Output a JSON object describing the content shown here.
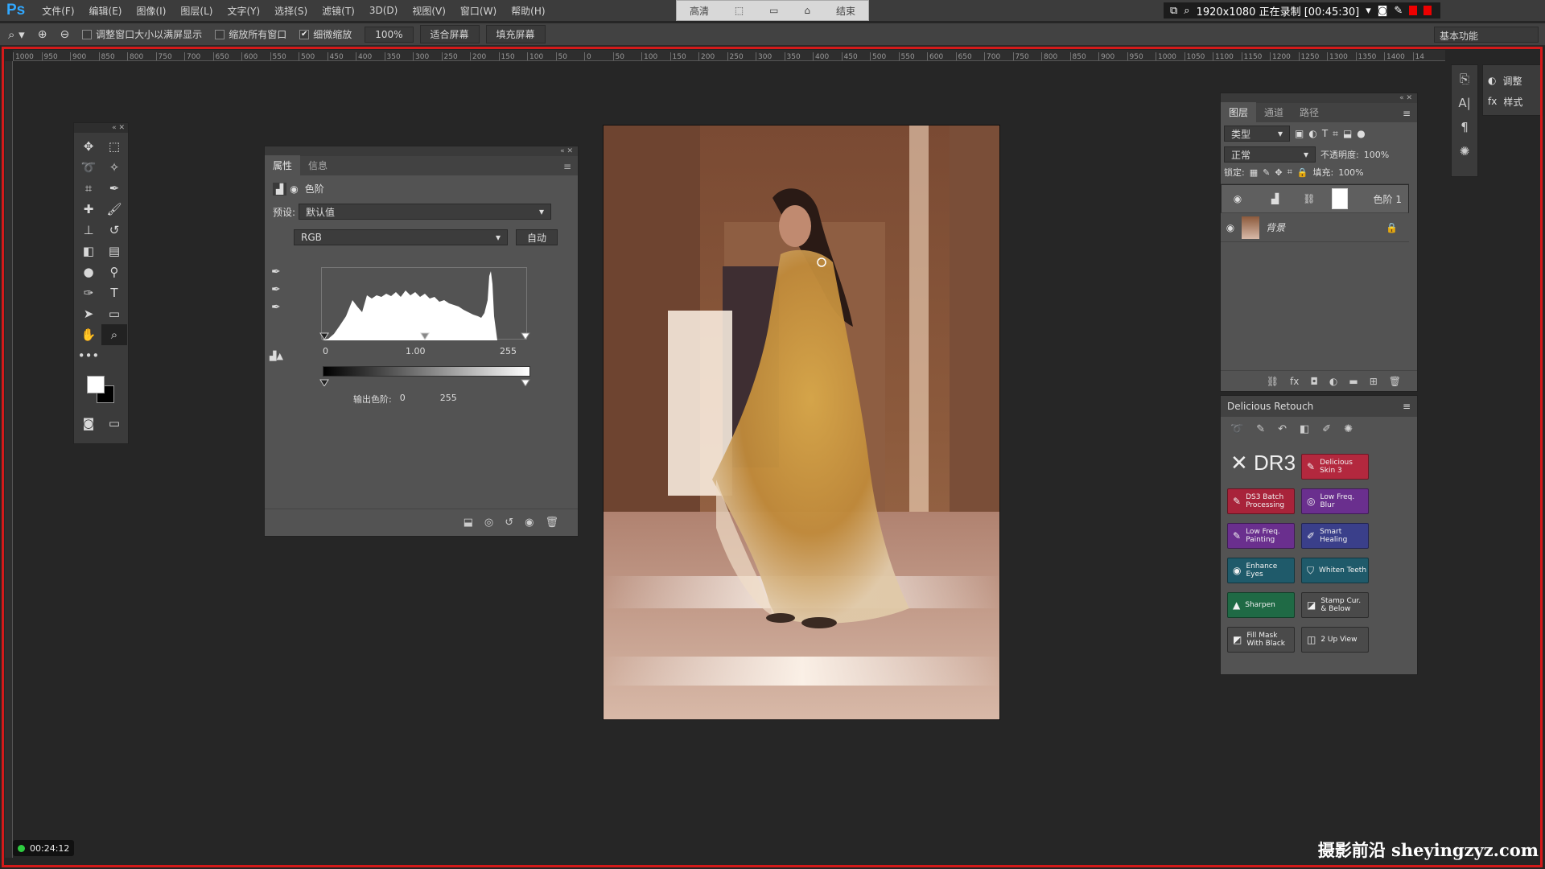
{
  "app": {
    "logo": "Ps"
  },
  "menu": [
    "文件(F)",
    "编辑(E)",
    "图像(I)",
    "图层(L)",
    "文字(Y)",
    "选择(S)",
    "滤镜(T)",
    "3D(D)",
    "视图(V)",
    "窗口(W)",
    "帮助(H)"
  ],
  "recorder_toolbar": [
    "高清",
    "结束"
  ],
  "recorder_status": {
    "text": "1920x1080 正在录制 [00:45:30]"
  },
  "options": {
    "chk1": "调整窗口大小以满屏显示",
    "chk2": "缩放所有窗口",
    "chk3": "细微缩放",
    "zoom": "100%",
    "fit": "适合屏幕",
    "fill": "填充屏幕",
    "workspace": "基本功能"
  },
  "ruler": [
    "1000",
    "950",
    "900",
    "850",
    "800",
    "750",
    "700",
    "650",
    "600",
    "550",
    "500",
    "450",
    "400",
    "350",
    "300",
    "250",
    "200",
    "150",
    "100",
    "50",
    "0",
    "50",
    "100",
    "150",
    "200",
    "250",
    "300",
    "350",
    "400",
    "450",
    "500",
    "550",
    "600",
    "650",
    "700",
    "750",
    "800",
    "850",
    "900",
    "950",
    "1000",
    "1050",
    "1100",
    "1150",
    "1200",
    "1250",
    "1300",
    "1350",
    "1400",
    "14"
  ],
  "properties": {
    "tabs": [
      "属性",
      "信息"
    ],
    "type_label": "色阶",
    "preset_label": "预设:",
    "preset_value": "默认值",
    "channel": "RGB",
    "auto": "自动",
    "input_black": "0",
    "input_gamma": "1.00",
    "input_white": "255",
    "output_label": "输出色阶:",
    "output_black": "0",
    "output_white": "255"
  },
  "layers": {
    "tabs": [
      "图层",
      "通道",
      "路径"
    ],
    "filter": "类型",
    "blend": "正常",
    "opacity_label": "不透明度:",
    "opacity": "100%",
    "lock_label": "锁定:",
    "fill_label": "填充:",
    "fill": "100%",
    "items": [
      {
        "name": "色阶 1"
      },
      {
        "name": "背景"
      }
    ]
  },
  "retouch": {
    "title": "Delicious Retouch",
    "logo": "DR3",
    "buttons": [
      {
        "label": "Delicious Skin 3",
        "color": "#b3283e"
      },
      {
        "label": "DS3 Batch Processing",
        "color": "#a8233a"
      },
      {
        "label": "Low Freq. Blur",
        "color": "#6a2f8e"
      },
      {
        "label": "Low Freq. Painting",
        "color": "#6a2f8e"
      },
      {
        "label": "Smart Healing",
        "color": "#3a3f8a"
      },
      {
        "label": "Enhance Eyes",
        "color": "#1f5a6a"
      },
      {
        "label": "Whiten Teeth",
        "color": "#1f5a6a"
      },
      {
        "label": "Sharpen",
        "color": "#1f6a45"
      },
      {
        "label": "Stamp Cur. & Below",
        "color": "#4a4a4a"
      },
      {
        "label": "Fill Mask With Black",
        "color": "#4a4a4a"
      },
      {
        "label": "2 Up View",
        "color": "#4a4a4a"
      }
    ]
  },
  "dock": {
    "adjust": "调整",
    "styles": "样式"
  },
  "timer": "00:24:12",
  "watermark": "摄影前沿 sheyingzyz.com"
}
